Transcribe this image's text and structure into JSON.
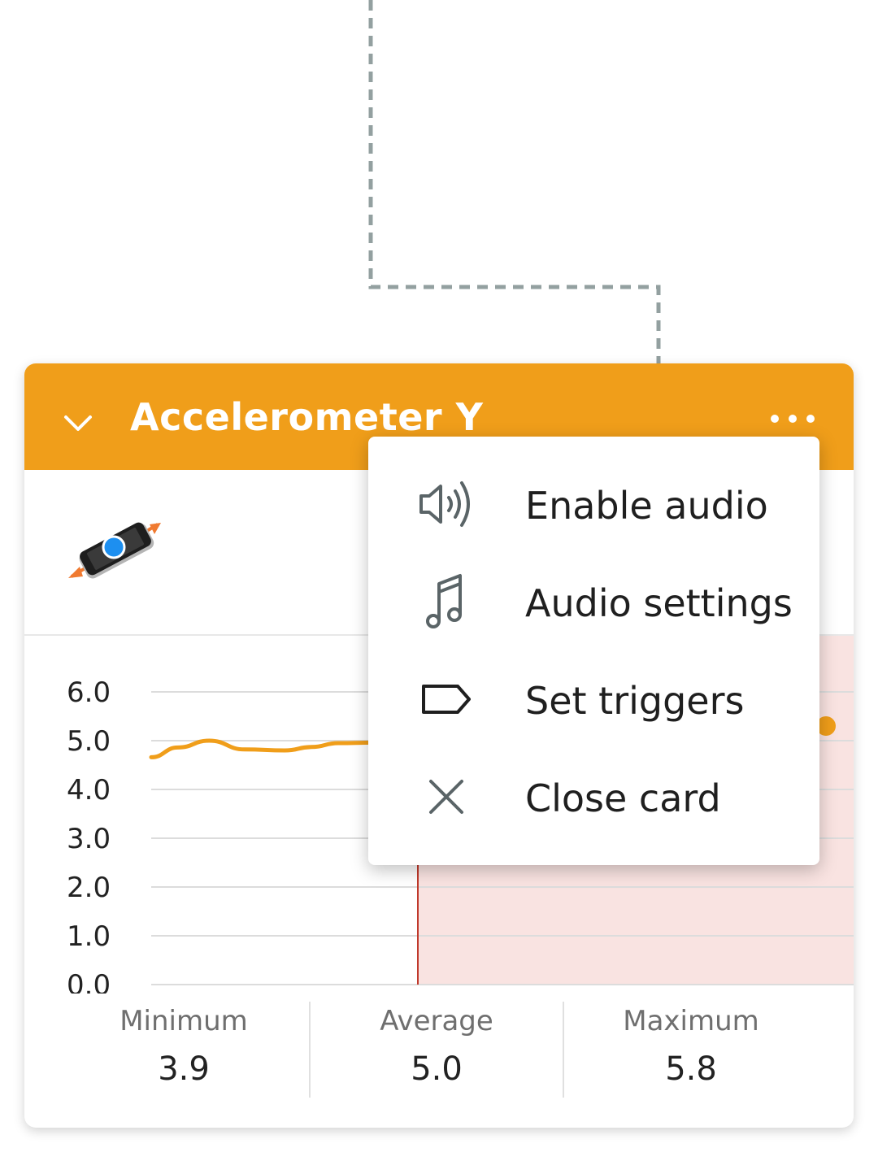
{
  "card": {
    "title": "Accelerometer Y",
    "header_color": "#f09e1a",
    "collapse_icon": "chevron-down-icon",
    "more_icon": "more-horizontal-icon",
    "sensor_icon": "phone-y-axis-icon"
  },
  "menu": {
    "items": [
      {
        "label": "Enable audio",
        "icon": "speaker-icon"
      },
      {
        "label": "Audio settings",
        "icon": "music-note-icon"
      },
      {
        "label": "Set triggers",
        "icon": "label-tag-icon"
      },
      {
        "label": "Close card",
        "icon": "close-icon"
      }
    ]
  },
  "stats": {
    "minimum_label": "Minimum",
    "minimum_value": "3.9",
    "average_label": "Average",
    "average_value": "5.0",
    "maximum_label": "Maximum",
    "maximum_value": "5.8"
  },
  "chart_data": {
    "type": "line",
    "y_ticks": [
      "6.0",
      "5.0",
      "4.0",
      "3.0",
      "2.0",
      "1.0",
      "0.0"
    ],
    "ylim": [
      0,
      6
    ],
    "grid": true,
    "line_color": "#f09e1a",
    "highlight_region_color": "#f9e3e1",
    "marker_line_color": "#c0392b",
    "series": [
      {
        "x": [
          0,
          0.12,
          0.26,
          0.42,
          0.6,
          0.72,
          0.84,
          1.0
        ],
        "values": [
          4.66,
          4.86,
          5.0,
          4.82,
          4.8,
          4.87,
          4.95,
          4.96
        ]
      }
    ],
    "live_point": 5.3
  }
}
